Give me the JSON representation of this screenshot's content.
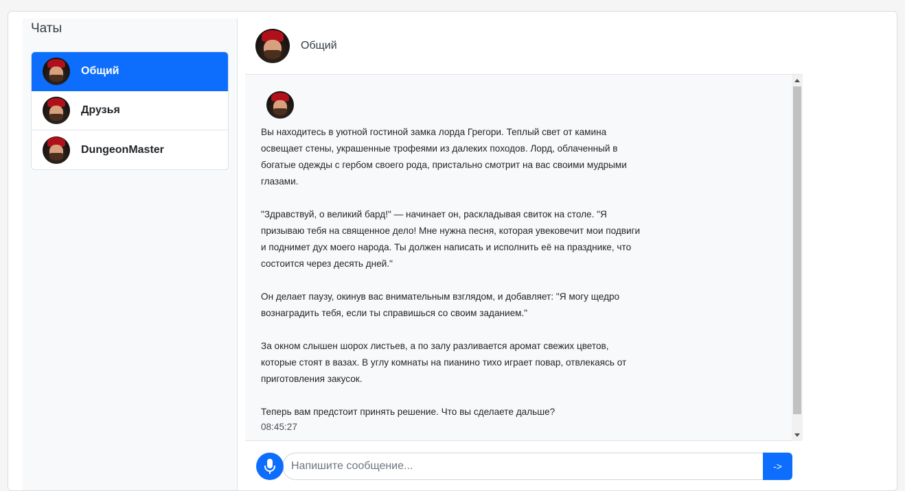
{
  "sidebar": {
    "title": "Чаты",
    "items": [
      {
        "label": "Общий",
        "active": true,
        "icon": "avatar-icon"
      },
      {
        "label": "Друзья",
        "active": false,
        "icon": "avatar-icon"
      },
      {
        "label": "DungeonMaster",
        "active": false,
        "icon": "avatar-icon"
      }
    ]
  },
  "chat": {
    "title": "Общий",
    "messages": [
      {
        "text": "Вы находитесь в уютной гостиной замка лорда Грегори. Теплый свет от камина освещает стены, украшенные трофеями из далеких походов. Лорд, облаченный в богатые одежды с гербом своего рода, пристально смотрит на вас своими мудрыми глазами.\n\n\"Здравствуй, о великий бард!\" — начинает он, раскладывая свиток на столе. \"Я призываю тебя на священное дело! Мне нужна песня, которая увековечит мои подвиги и поднимет дух моего народа. Ты должен написать и исполнить её на празднике, что состоится через десять дней.\"\n\nОн делает паузу, окинув вас внимательным взглядом, и добавляет: \"Я могу щедро вознаградить тебя, если ты справишься со своим заданием.\"\n\nЗа окном слышен шорох листьев, а по залу разливается аромат свежих цветов, которые стоят в вазах. В углу комнаты на пианино тихо играет повар, отвлекаясь от приготовления закусок.\n\nТеперь вам предстоит принять решение. Что вы сделаете дальше?",
        "time": "08:45:27"
      }
    ]
  },
  "composer": {
    "placeholder": "Напишите сообщение...",
    "send_label": "->",
    "mic_icon": "microphone-icon"
  },
  "colors": {
    "accent": "#0d6efd",
    "sidebar_bg": "#f8f9fa",
    "messages_bg": "#f8f9fa"
  }
}
